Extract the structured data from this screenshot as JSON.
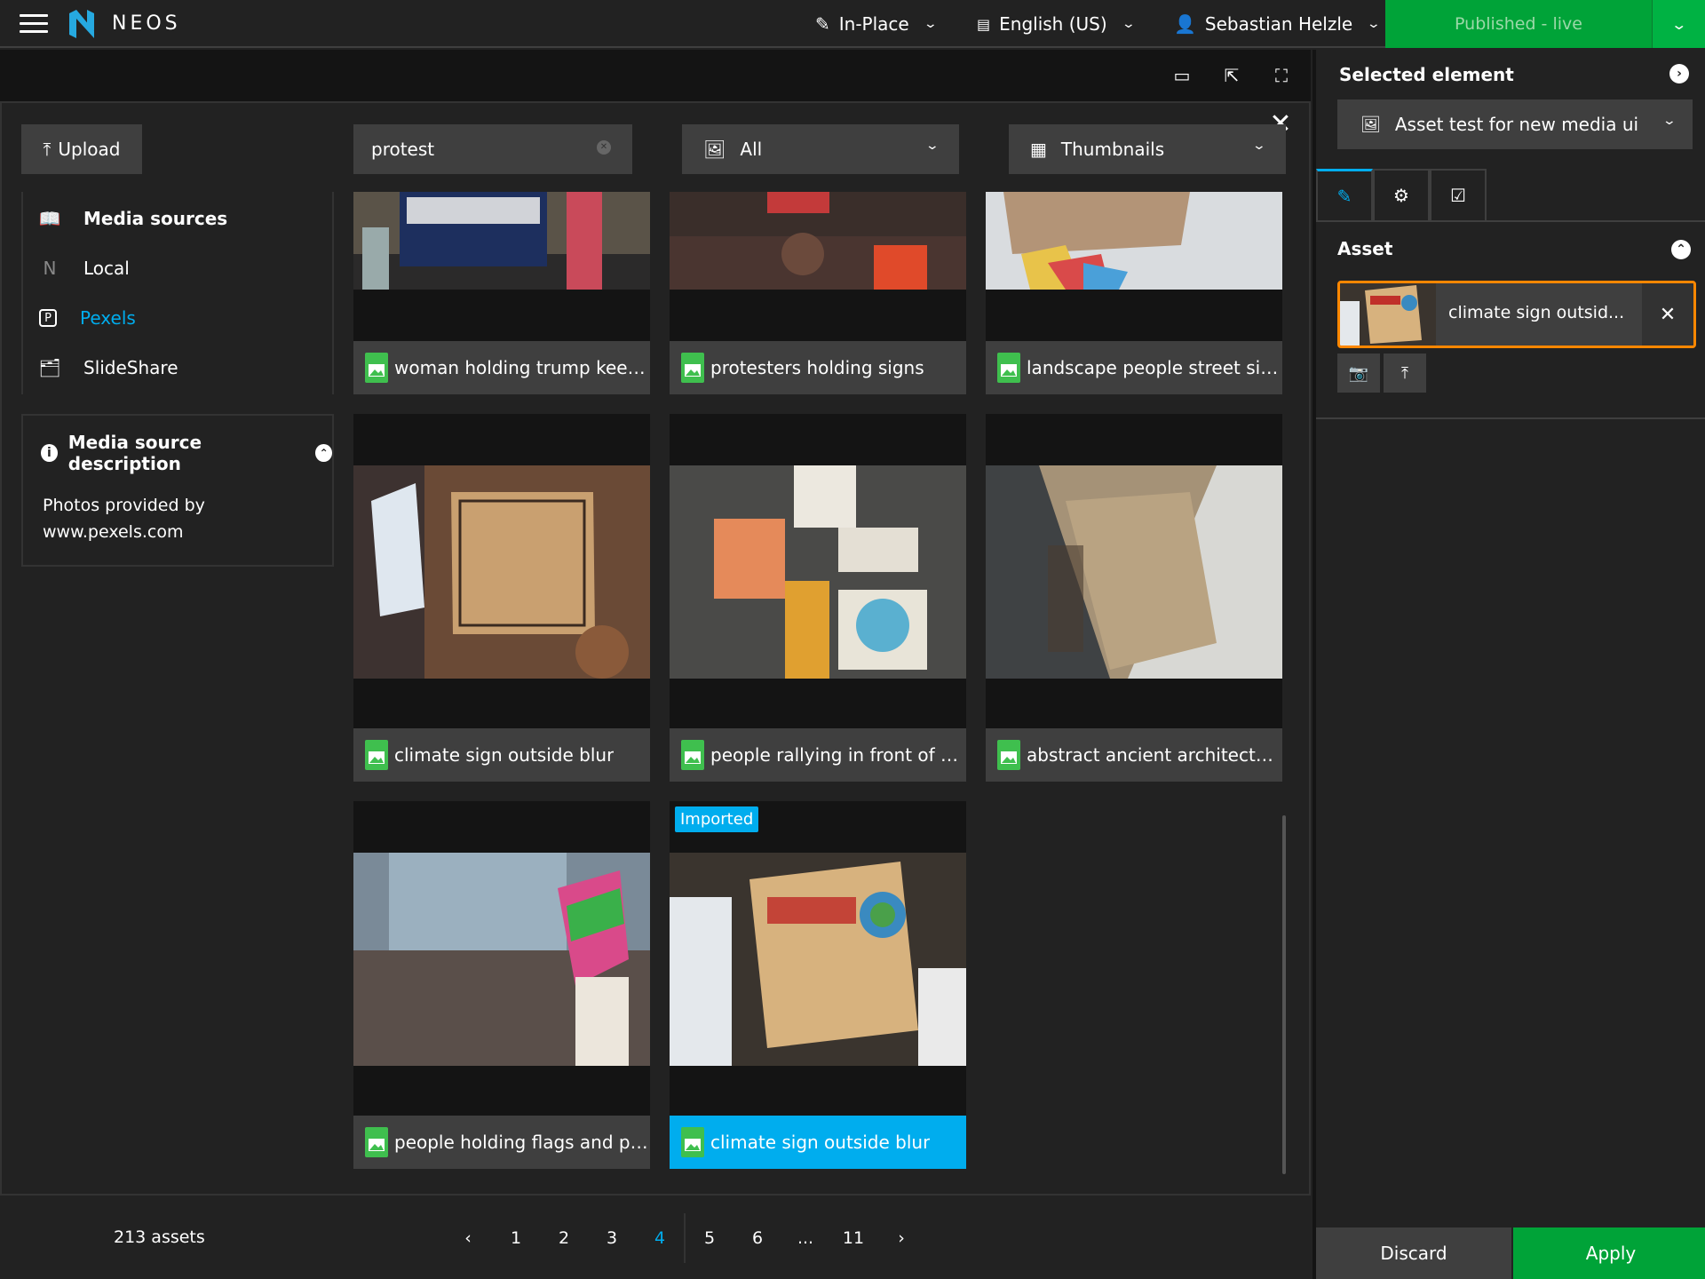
{
  "topbar": {
    "brand": "NEOS",
    "edit_mode": "In-Place",
    "language": "English (US)",
    "user": "Sebastian Helzle",
    "publish": "Published - live"
  },
  "media": {
    "upload_label": "Upload",
    "search_value": "protest",
    "filter_value": "All",
    "view_mode": "Thumbnails",
    "sources_header": "Media sources",
    "sources": [
      {
        "label": "Local",
        "icon": "neos-icon"
      },
      {
        "label": "Pexels",
        "icon": "pexels-icon",
        "active": true
      },
      {
        "label": "SlideShare",
        "icon": "slideshare-icon"
      }
    ],
    "description_title": "Media source description",
    "description_text": "Photos provided by www.pexels.com",
    "assets": [
      {
        "caption": "woman holding trump keep..."
      },
      {
        "caption": "protesters holding signs"
      },
      {
        "caption": "landscape people street sign"
      },
      {
        "caption": "climate sign outside blur"
      },
      {
        "caption": "people rallying in front of c..."
      },
      {
        "caption": "abstract ancient architectur..."
      },
      {
        "caption": "people holding flags and po..."
      },
      {
        "caption": "climate sign outside blur",
        "badge": "Imported",
        "selected": true
      }
    ],
    "asset_count": "213 assets",
    "pages": [
      "‹",
      "1",
      "2",
      "3",
      "4",
      "5",
      "6",
      "...",
      "11",
      "›"
    ],
    "active_page": "4"
  },
  "inspector": {
    "title": "Selected element",
    "node": "Asset test for new media ui",
    "group": "Asset",
    "asset_name": "climate sign outsid...",
    "discard": "Discard",
    "apply": "Apply"
  },
  "colors": {
    "accent": "#00adee",
    "success": "#00a338",
    "warning": "#ff8700",
    "background": "#222222",
    "panel": "#3f3f3f"
  }
}
